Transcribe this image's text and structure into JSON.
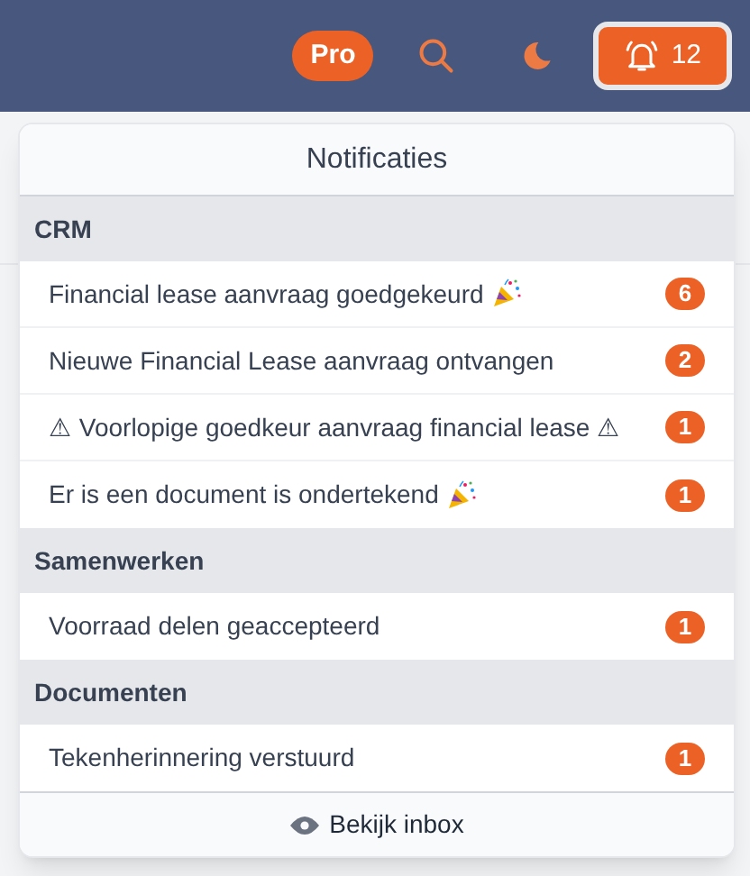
{
  "header": {
    "plan_badge": "Pro",
    "notifications_button": {
      "count": "12"
    }
  },
  "notifications": {
    "title": "Notificaties",
    "sections": [
      {
        "title": "CRM",
        "items": [
          {
            "text": "Financial lease aanvraag goedgekeurd",
            "celebration": true,
            "count": "6"
          },
          {
            "text": "Nieuwe Financial Lease aanvraag ontvangen",
            "celebration": false,
            "count": "2"
          },
          {
            "text": "⚠ Voorlopige goedkeur aanvraag financial lease ⚠",
            "celebration": false,
            "count": "1"
          },
          {
            "text": "Er is een document is ondertekend",
            "celebration": true,
            "count": "1"
          }
        ]
      },
      {
        "title": "Samenwerken",
        "items": [
          {
            "text": "Voorraad delen geaccepteerd",
            "celebration": false,
            "count": "1"
          }
        ]
      },
      {
        "title": "Documenten",
        "items": [
          {
            "text": "Tekenherinnering verstuurd",
            "celebration": false,
            "count": "1"
          }
        ]
      }
    ],
    "footer_link": "Bekijk inbox"
  }
}
